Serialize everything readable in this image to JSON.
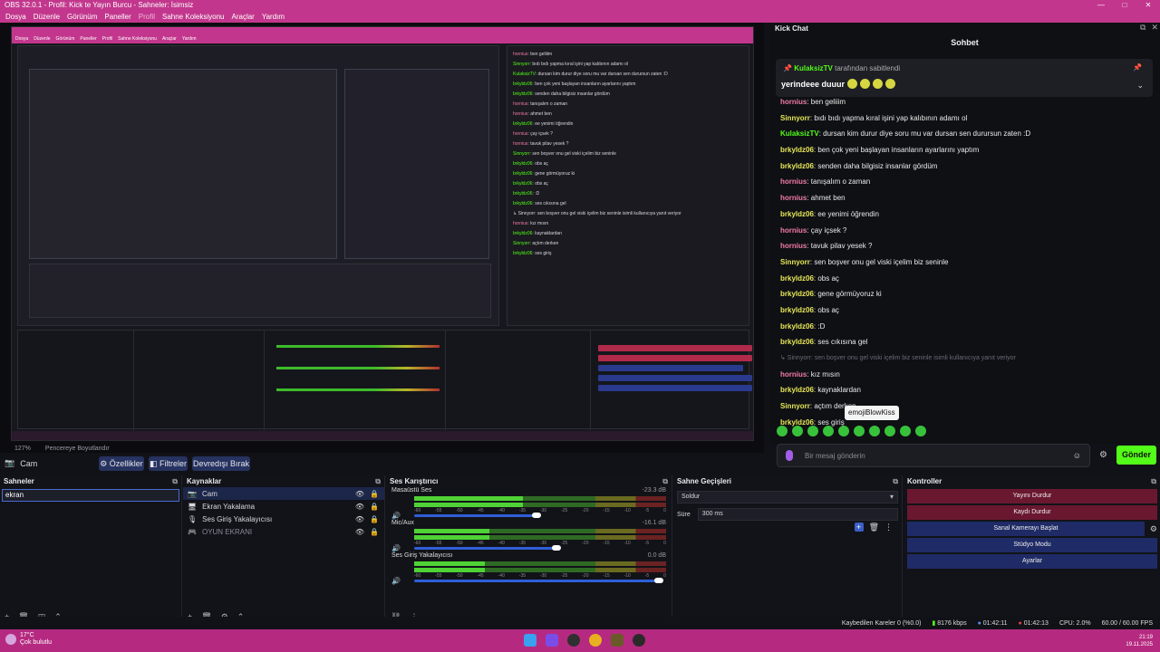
{
  "window": {
    "title": "OBS 32.0.1 - Profil: Kick te Yayın Burcu - Sahneler: İsimsiz",
    "controls": [
      "—",
      "□",
      "✕"
    ]
  },
  "menu": [
    {
      "label": "Dosya",
      "dim": false
    },
    {
      "label": "Düzenle",
      "dim": false
    },
    {
      "label": "Görünüm",
      "dim": false
    },
    {
      "label": "Paneller",
      "dim": false
    },
    {
      "label": "Profil",
      "dim": true
    },
    {
      "label": "Sahne Koleksiyonu",
      "dim": false
    },
    {
      "label": "Araçlar",
      "dim": false
    },
    {
      "label": "Yardım",
      "dim": false
    }
  ],
  "zoom": {
    "percent": "127%",
    "mode": "Pencereye Boyutlandır"
  },
  "toolbar": {
    "source_name": "Cam",
    "properties": "Özellikler",
    "filters": "Filtreler",
    "deactivate": "Devredışı Bırak"
  },
  "scenes": {
    "title": "Sahneler",
    "items": [
      "ekran"
    ]
  },
  "sources": {
    "title": "Kaynaklar",
    "items": [
      {
        "label": "Cam",
        "icon": "camera-icon",
        "active": true,
        "disabled": false
      },
      {
        "label": "Ekran Yakalama",
        "icon": "monitor-icon",
        "active": false,
        "disabled": false
      },
      {
        "label": "Ses Giriş Yakalayıcısı",
        "icon": "mic-icon",
        "active": false,
        "disabled": false
      },
      {
        "label": "OYUN EKRANI",
        "icon": "gamepad-icon",
        "active": false,
        "disabled": true
      }
    ]
  },
  "mixer": {
    "title": "Ses Karıştırıcı",
    "ticks": [
      "-60",
      "-55",
      "-50",
      "-45",
      "-40",
      "-35",
      "-30",
      "-25",
      "-20",
      "-15",
      "-10",
      "-5",
      "0"
    ],
    "channels": [
      {
        "name": "Masaüstü Ses",
        "db": "-23.3 dB",
        "level": 0.43,
        "volume": 0.5
      },
      {
        "name": "Mic/Aux",
        "db": "-16.1 dB",
        "level": 0.3,
        "volume": 0.58
      },
      {
        "name": "Ses Giriş Yakalayıcısı",
        "db": "0.0 dB",
        "level": 0.28,
        "volume": 1.0
      }
    ]
  },
  "transitions": {
    "title": "Sahne Geçişleri",
    "selected": "Soldur",
    "duration_label": "Süre",
    "duration": "300 ms"
  },
  "controls": {
    "title": "Kontroller",
    "buttons": [
      {
        "label": "Yayını Durdur",
        "style": "red"
      },
      {
        "label": "Kaydı Durdur",
        "style": "red"
      },
      {
        "label": "Sanal Kamerayı Başlat",
        "style": "blueS"
      },
      {
        "label": "Stüdyo Modu",
        "style": "blue"
      },
      {
        "label": "Ayarlar",
        "style": "blue"
      }
    ]
  },
  "status": {
    "dropped": "Kaybedilen Kareler 0 (%0.0)",
    "bitrate": "8176 kbps",
    "stream_time": "01:42:11",
    "rec_time": "01:42:13",
    "cpu": "CPU: 2.0%",
    "fps": "60.00 / 60.00 FPS"
  },
  "taskbar": {
    "temp": "17°C",
    "weather": "Çok bulutlu",
    "time": "21:19",
    "date": "19.11.2025"
  },
  "chat": {
    "window_title": "Kick Chat",
    "header": "Sohbet",
    "pinned_by_user": "KulaksizTV",
    "pinned_by_suffix": "tarafından sabitlendi",
    "pinned_message": "yerindeee duuur",
    "messages": [
      {
        "user": "hornius",
        "text": "ben geliiim",
        "color": "up",
        "reply": false
      },
      {
        "user": "Sinnyorr",
        "text": "bıdı bıdı yapma kıral işini yap kalıbının adamı ol",
        "color": "uy",
        "reply": false
      },
      {
        "user": "KulaksizTV",
        "text": "dursan kim durur diye soru mu var dursan sen durursun zaten :D",
        "color": "ug",
        "reply": false
      },
      {
        "user": "brkyldz06",
        "text": "ben çok yeni başlayan insanların ayarlarını yaptım",
        "color": "uy",
        "reply": false
      },
      {
        "user": "brkyldz06",
        "text": "senden daha bilgisiz insanlar gördüm",
        "color": "uy",
        "reply": false
      },
      {
        "user": "hornius",
        "text": "tanışalım o zaman",
        "color": "up",
        "reply": false
      },
      {
        "user": "hornius",
        "text": "ahmet ben",
        "color": "up",
        "reply": false
      },
      {
        "user": "brkyldz06",
        "text": "ee yenimi öğrendin",
        "color": "uy",
        "reply": false
      },
      {
        "user": "hornius",
        "text": "çay içsek ?",
        "color": "up",
        "reply": false
      },
      {
        "user": "hornius",
        "text": "tavuk pilav yesek ?",
        "color": "up",
        "reply": false
      },
      {
        "user": "Sinnyorr",
        "text": "sen boşver onu gel viski içelim biz seninle",
        "color": "uy",
        "reply": false
      },
      {
        "user": "brkyldz06",
        "text": "obs aç",
        "color": "uy",
        "reply": false
      },
      {
        "user": "brkyldz06",
        "text": "gene görmüyoruz ki",
        "color": "uy",
        "reply": false
      },
      {
        "user": "brkyldz06",
        "text": "obs aç",
        "color": "uy",
        "reply": false
      },
      {
        "user": "brkyldz06",
        "text": ":D",
        "color": "uy",
        "reply": false
      },
      {
        "user": "brkyldz06",
        "text": "ses cıkısına gel",
        "color": "uy",
        "reply": false
      },
      {
        "user": "",
        "text": "↳ Sinnyorr: sen boşver onu gel viski içelim biz seninle isimli kullanıcıya yanıt veriyor",
        "color": "",
        "reply": true
      },
      {
        "user": "hornius",
        "text": "kız mısın",
        "color": "up",
        "reply": false
      },
      {
        "user": "brkyldz06",
        "text": "kaynaklardan",
        "color": "uy",
        "reply": false
      },
      {
        "user": "Sinnyorr",
        "text": "açtım derken",
        "color": "uy",
        "reply": false
      },
      {
        "user": "brkyldz06",
        "text": "ses giriş",
        "color": "uy",
        "reply": false
      }
    ],
    "tooltip": "emojiBlowKiss",
    "input_placeholder": "Bir mesaj gönderin",
    "send": "Gönder"
  }
}
